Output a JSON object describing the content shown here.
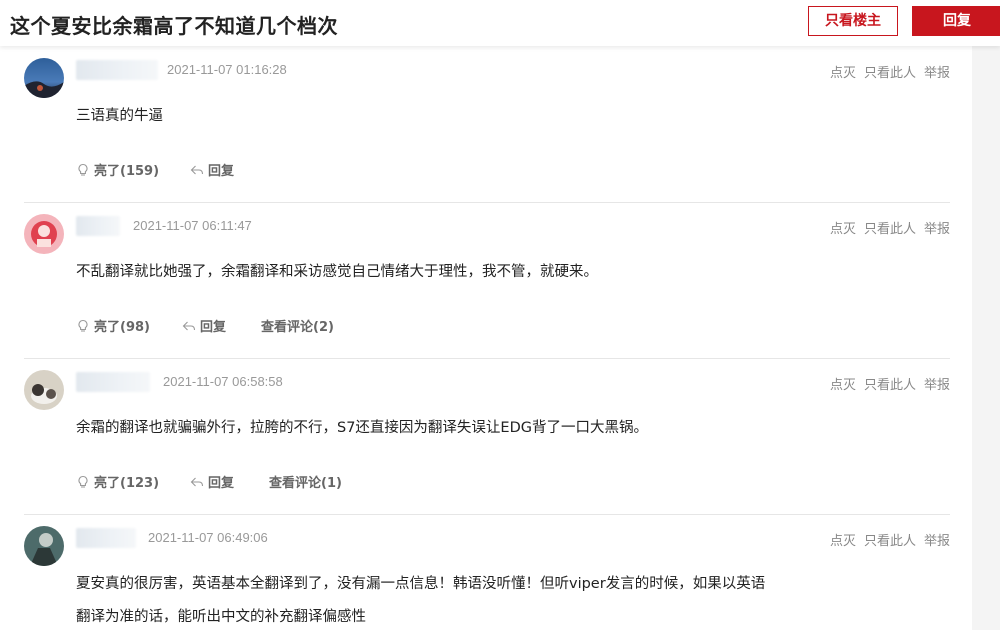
{
  "header": {
    "title": "这个夏安比余霜高了不知道几个档次",
    "only_op_label": "只看楼主",
    "reply_label": "回复"
  },
  "post_actions": {
    "dislike": "点灭",
    "only_this": "只看此人",
    "report": "举报"
  },
  "posts": [
    {
      "time": "2021-11-07 01:16:28",
      "content_lines": [
        "三语真的牛逼"
      ],
      "likes_label": "亮了(159)",
      "reply_label": "回复",
      "comments_label": ""
    },
    {
      "time": "2021-11-07 06:11:47",
      "content_lines": [
        "不乱翻译就比她强了，余霜翻译和采访感觉自己情绪大于理性，我不管，就硬来。"
      ],
      "likes_label": "亮了(98)",
      "reply_label": "回复",
      "comments_label": "查看评论(2)"
    },
    {
      "time": "2021-11-07 06:58:58",
      "content_lines": [
        "余霜的翻译也就骗骗外行，拉胯的不行，S7还直接因为翻译失误让EDG背了一口大黑锅。"
      ],
      "likes_label": "亮了(123)",
      "reply_label": "回复",
      "comments_label": "查看评论(1)"
    },
    {
      "time": "2021-11-07 06:49:06",
      "content_lines": [
        "夏安真的很厉害，英语基本全翻译到了，没有漏一点信息！韩语没听懂！但听viper发言的时候，如果以英语",
        "翻译为准的话，能听出中文的补充翻译偏感性"
      ],
      "likes_label": "",
      "reply_label": "",
      "comments_label": ""
    }
  ],
  "colors": {
    "brand_red": "#c8161e",
    "muted_text": "#999999",
    "divider": "#e6e6e6"
  }
}
